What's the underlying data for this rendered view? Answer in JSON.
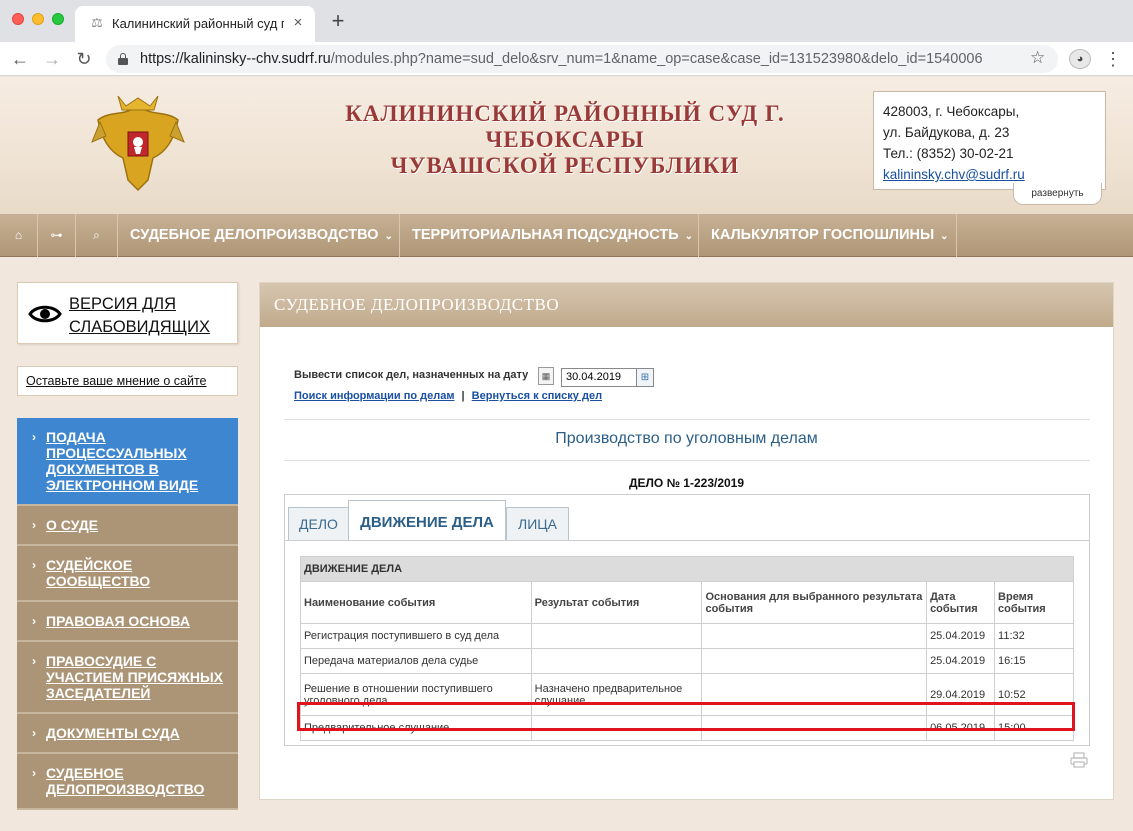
{
  "browser": {
    "tab_title": "Калининский районный суд г",
    "url_host": "https://kalininsky--chv.sudrf.ru",
    "url_path": "/modules.php?name=sud_delo&srv_num=1&name_op=case&case_id=131523980&delo_id=1540006"
  },
  "header": {
    "title_line1": "КАЛИНИНСКИЙ РАЙОННЫЙ СУД Г.",
    "title_line2": "ЧЕБОКСАРЫ",
    "title_line3": "ЧУВАШСКОЙ РЕСПУБЛИКИ",
    "address1": "428003, г. Чебоксары,",
    "address2": "ул. Байдукова, д. 23",
    "phone": "Тел.: (8352) 30-02-21",
    "email": "kalininsky.chv@sudrf.ru",
    "expand_label": "развернуть"
  },
  "nav": {
    "home_icon": "⌂",
    "sitemap_icon": "⊶",
    "search_icon": "⌕",
    "items": [
      "СУДЕБНОЕ ДЕЛОПРОИЗВОДСТВО",
      "ТЕРРИТОРИАЛЬНАЯ ПОДСУДНОСТЬ",
      "КАЛЬКУЛЯТОР ГОСПОШЛИНЫ"
    ]
  },
  "sidebar": {
    "vision_line1": "ВЕРСИЯ ДЛЯ",
    "vision_line2": "СЛАБОВИДЯЩИХ",
    "feedback": "Оставьте ваше мнение о сайте",
    "menu": [
      {
        "label": "ПОДАЧА ПРОЦЕССУАЛЬНЫХ ДОКУМЕНТОВ В ЭЛЕКТРОННОМ ВИДЕ"
      },
      {
        "label": "О СУДЕ"
      },
      {
        "label": "СУДЕЙСКОЕ СООБЩЕСТВО"
      },
      {
        "label": "ПРАВОВАЯ ОСНОВА"
      },
      {
        "label": "ПРАВОСУДИЕ С УЧАСТИЕМ ПРИСЯЖНЫХ ЗАСЕДАТЕЛЕЙ"
      },
      {
        "label": "ДОКУМЕНТЫ СУДА"
      },
      {
        "label": "СУДЕБНОЕ ДЕЛОПРОИЗВОДСТВО"
      }
    ]
  },
  "main": {
    "header": "СУДЕБНОЕ ДЕЛОПРОИЗВОДСТВО",
    "date_label": "Вывести список дел, назначенных на дату",
    "date_value": "30.04.2019",
    "link_search": "Поиск информации по делам",
    "link_sep": "|",
    "link_back": "Вернуться к списку дел",
    "section_title": "Производство по уголовным делам",
    "case_number": "ДЕЛО № 1-223/2019",
    "tabs": [
      "ДЕЛО",
      "ДВИЖЕНИЕ ДЕЛА",
      "ЛИЦА"
    ],
    "table": {
      "caption": "ДВИЖЕНИЕ ДЕЛА",
      "headers": [
        "Наименование события",
        "Результат события",
        "Основания для выбранного результата события",
        "Дата события",
        "Время события"
      ],
      "rows": [
        [
          "Регистрация поступившего в суд дела",
          "",
          "",
          "25.04.2019",
          "11:32"
        ],
        [
          "Передача материалов дела судье",
          "",
          "",
          "25.04.2019",
          "16:15"
        ],
        [
          "Решение в отношении поступившего уголовного дела",
          "Назначено предварительное слушание",
          "",
          "29.04.2019",
          "10:52"
        ],
        [
          "Предварительное слушание",
          "",
          "",
          "06.05.2019",
          "15:00"
        ]
      ]
    }
  }
}
